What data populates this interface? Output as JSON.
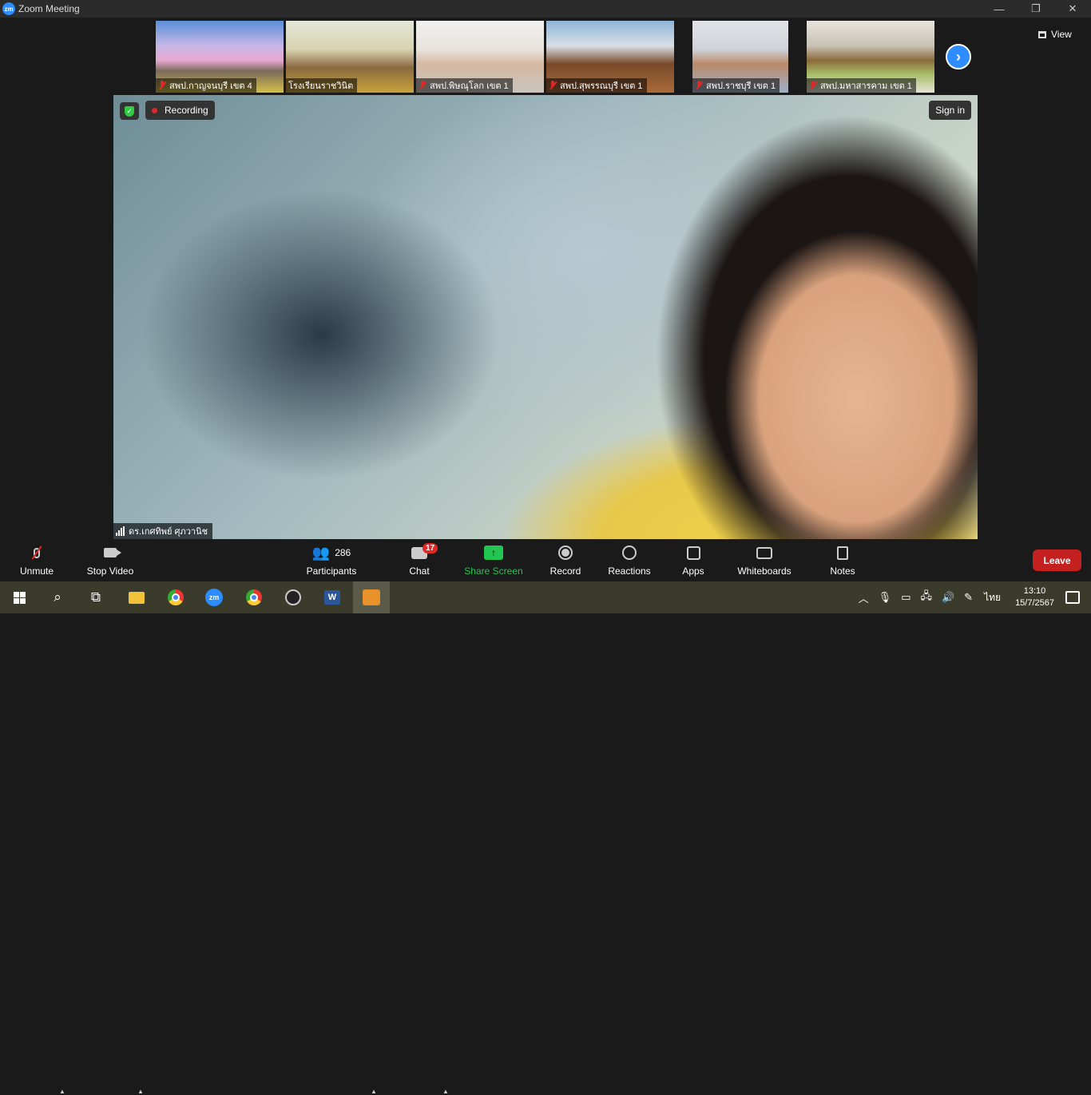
{
  "window": {
    "app_logo": "zm",
    "title": "Zoom Meeting",
    "controls": {
      "minimize": "—",
      "restore": "❐",
      "close": "✕"
    }
  },
  "thumbnails": [
    {
      "name": "สพป.กาญจนบุรี เขต 4",
      "muted": true
    },
    {
      "name": "โรงเรียนราชวินิต",
      "muted": false
    },
    {
      "name": "สพป.พิษณุโลก เขต 1",
      "muted": true
    },
    {
      "name": "สพป.สุพรรณบุรี เขต 1",
      "muted": true
    },
    {
      "name": "สพป.ราชบุรี เขต 1",
      "muted": true
    },
    {
      "name": "สพป.มหาสารคาม เขต 1",
      "muted": true
    }
  ],
  "next_page_glyph": "›",
  "view_label": "View",
  "main_video": {
    "recording_label": "Recording",
    "sign_in_label": "Sign in",
    "speaker_name": "ดร.เกศทิพย์ ศุภวานิช"
  },
  "toolbar": {
    "unmute": "Unmute",
    "stop_video": "Stop Video",
    "participants": "Participants",
    "participant_count": "286",
    "chat": "Chat",
    "chat_badge": "17",
    "share_screen": "Share Screen",
    "record": "Record",
    "reactions": "Reactions",
    "apps": "Apps",
    "whiteboards": "Whiteboards",
    "notes": "Notes",
    "leave": "Leave"
  },
  "taskbar": {
    "zoom_app_label": "zm",
    "word_label": "W",
    "input_language": "ไทย",
    "time": "13:10",
    "date": "15/7/2567"
  },
  "colors": {
    "accent_blue": "#2d8cff",
    "share_green": "#23c552",
    "leave_red": "#c42020",
    "recording_red": "#e02828"
  }
}
